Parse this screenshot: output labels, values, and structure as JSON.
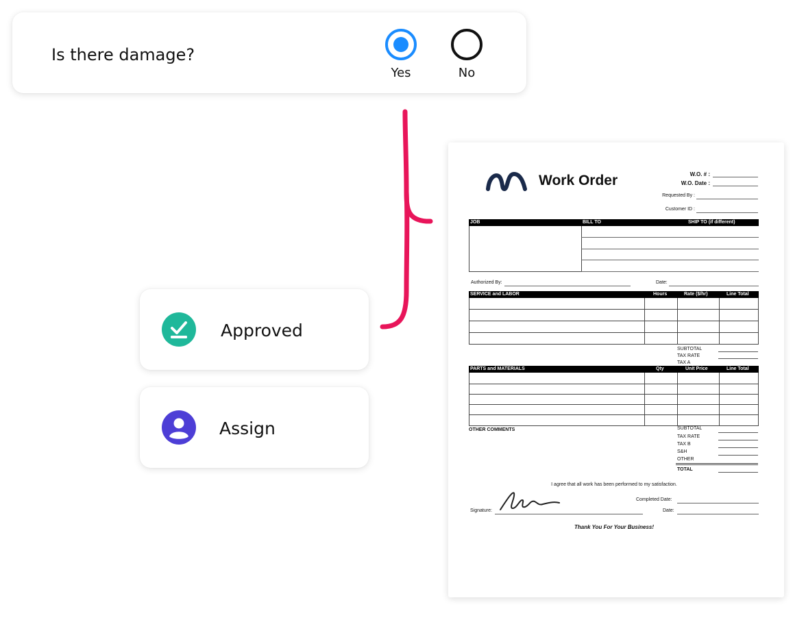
{
  "question": {
    "text": "Is there damage?",
    "options": [
      {
        "label": "Yes",
        "selected": true
      },
      {
        "label": "No",
        "selected": false
      }
    ]
  },
  "actions": {
    "approved": {
      "label": "Approved",
      "icon": "check-download-icon",
      "color": "#1fb89a"
    },
    "assign": {
      "label": "Assign",
      "icon": "user-icon",
      "color": "#4d3ed6"
    }
  },
  "connector_color": "#e8155a",
  "accent": "#1a8cff",
  "document": {
    "title": "Work Order",
    "header_fields": [
      "W.O. # :",
      "W.O. Date :",
      "Requested By :",
      "Customer ID :"
    ],
    "section1": {
      "job": "JOB",
      "bill_to": "BILL TO",
      "ship_to": "SHIP TO (if different)"
    },
    "authorized_by": "Authorized By:",
    "date": "Date:",
    "service": {
      "title": "SERVICE and LABOR",
      "hours": "Hours",
      "rate": "Rate ($/hr)",
      "line_total": "Line Total"
    },
    "service_totals": [
      "SUBTOTAL",
      "TAX RATE",
      "TAX A"
    ],
    "parts": {
      "title": "PARTS and MATERIALS",
      "qty": "Qty",
      "unit_price": "Unit Price",
      "line_total": "Line Total"
    },
    "other_comments": "OTHER COMMENTS",
    "parts_totals": [
      "SUBTOTAL",
      "TAX RATE",
      "TAX B",
      "S&H",
      "OTHER"
    ],
    "total": "TOTAL",
    "agreement": "I agree that all work has been performed to my satisfaction.",
    "completed_date": "Completed Date:",
    "signature": "Signature:",
    "sig_date": "Date:",
    "thanks": "Thank You For Your Business!"
  }
}
